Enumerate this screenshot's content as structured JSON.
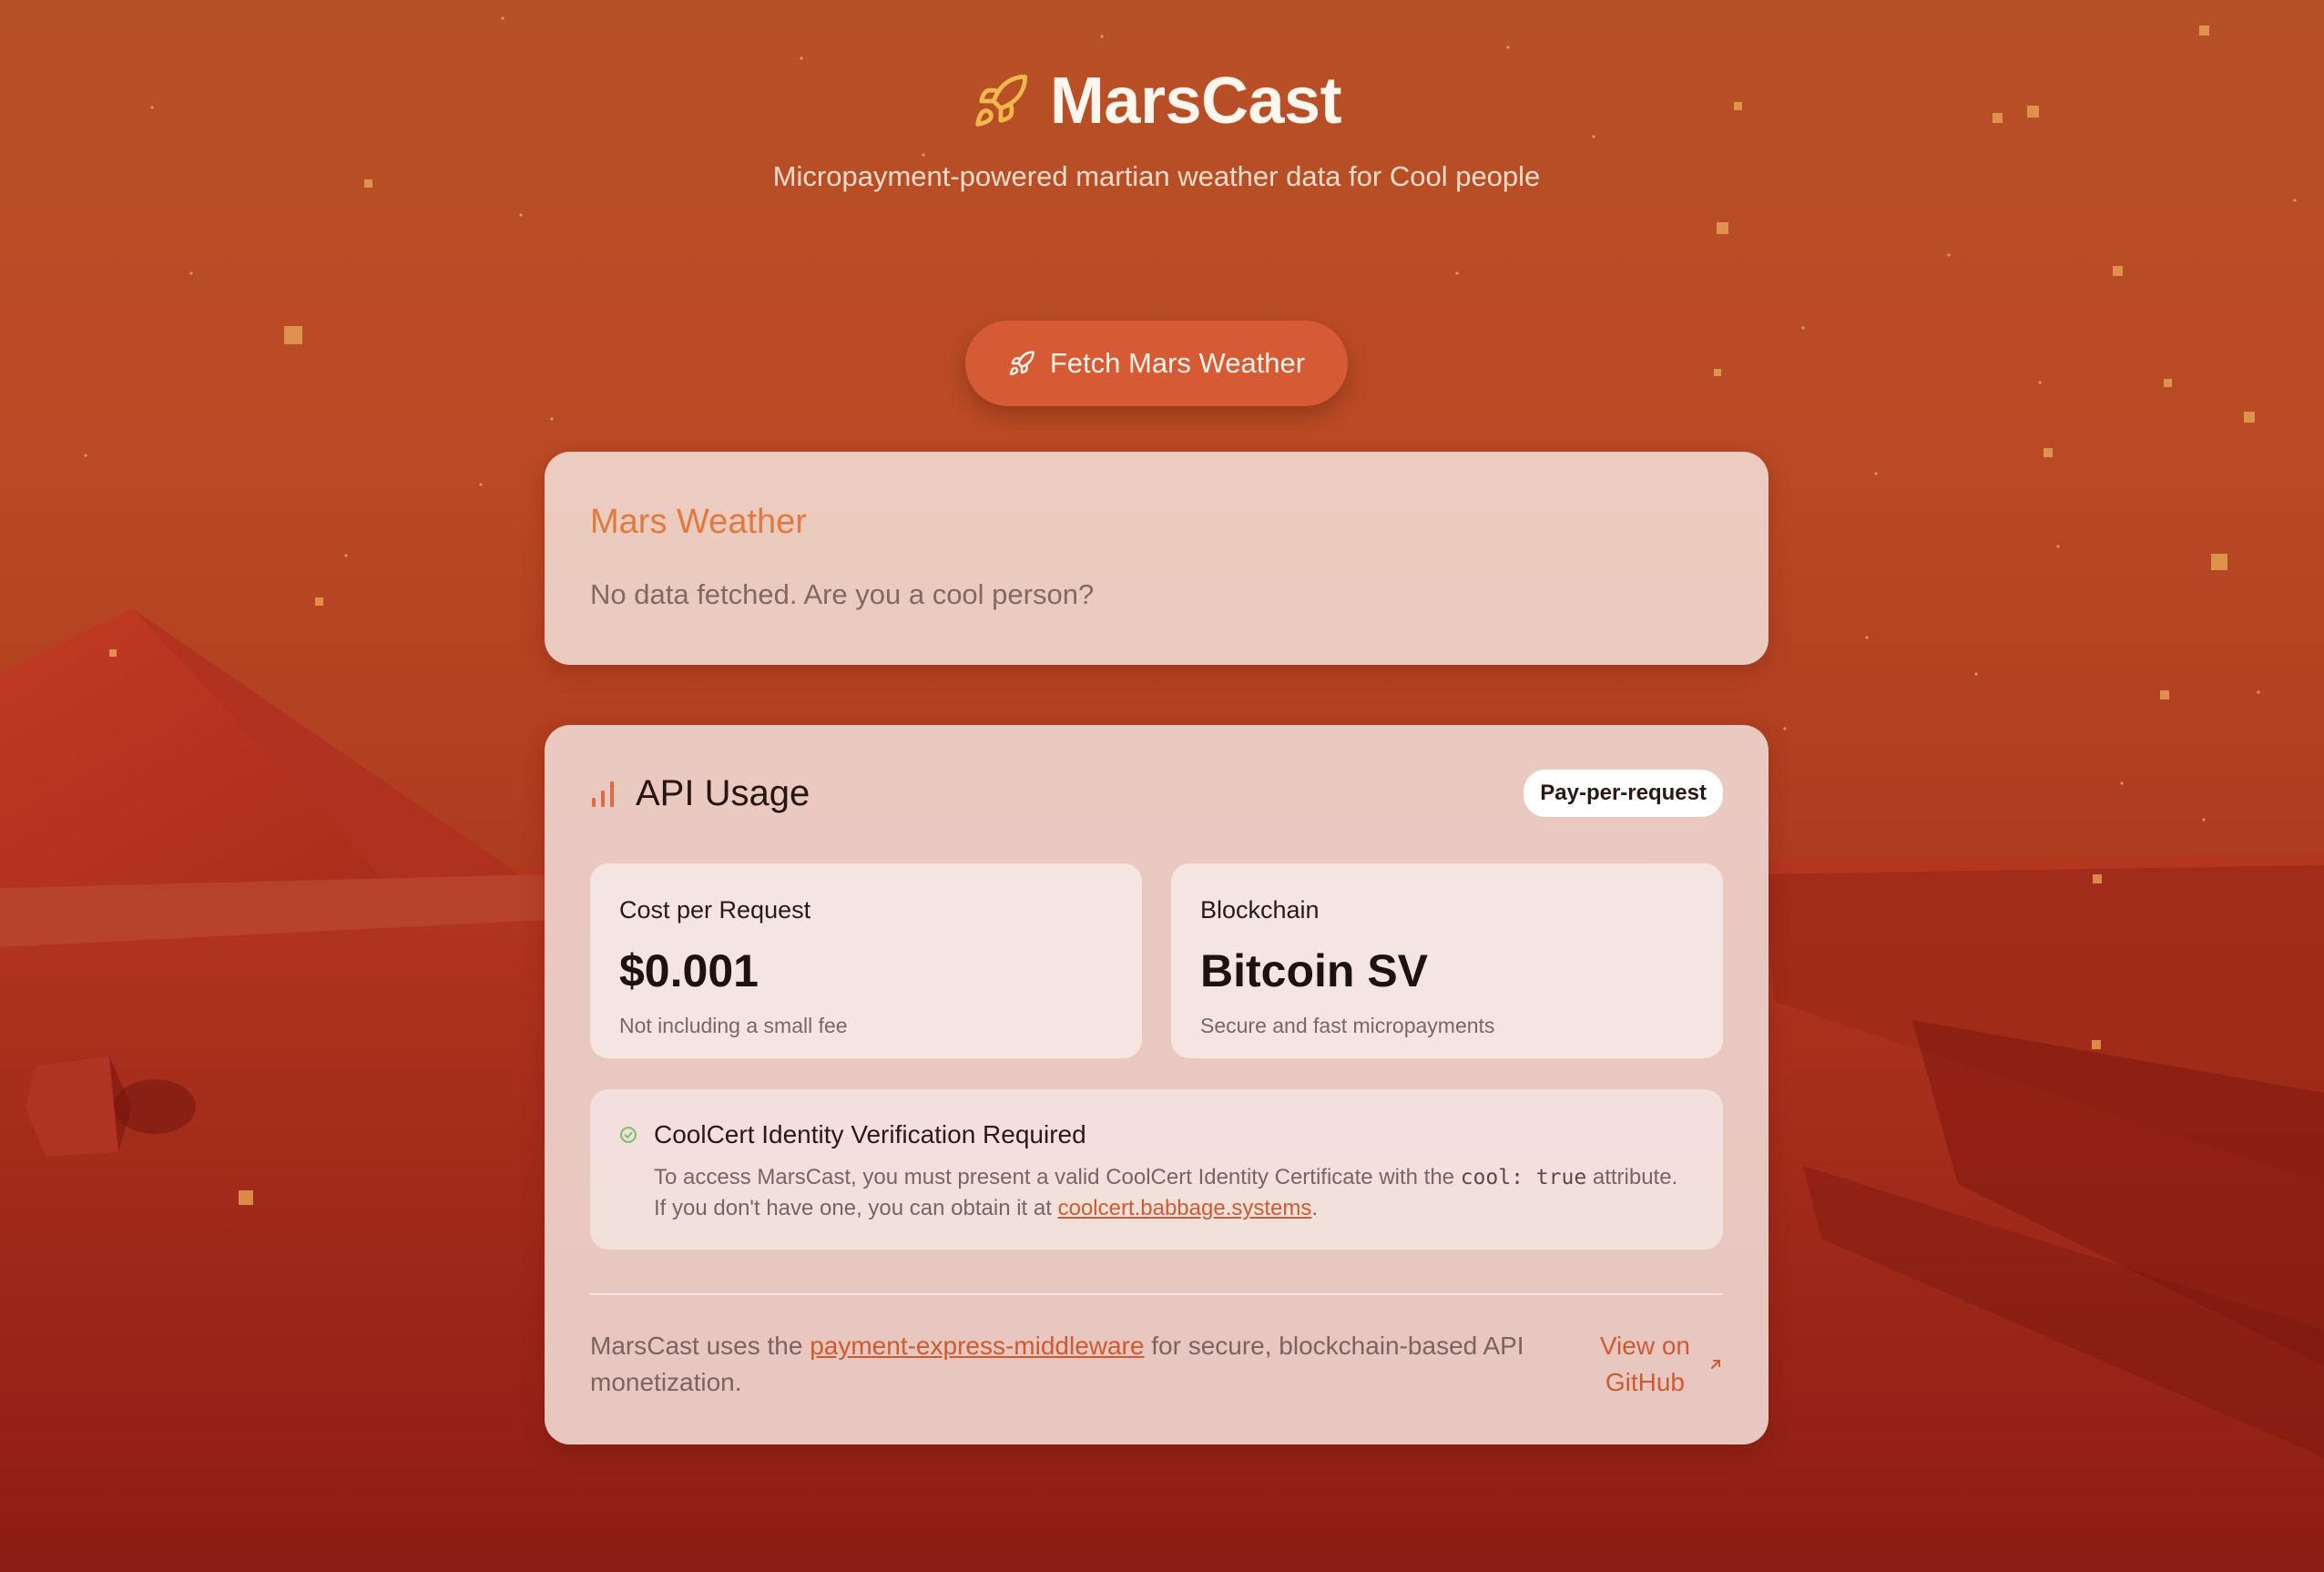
{
  "app": {
    "title": "MarsCast",
    "tagline": "Micropayment-powered martian weather data for Cool people"
  },
  "fetch_button": {
    "label": "Fetch Mars Weather",
    "icon": "rocket-icon"
  },
  "weather": {
    "title": "Mars Weather",
    "empty_message": "No data fetched. Are you a cool person?"
  },
  "usage": {
    "title": "API Usage",
    "icon": "bar-chart-icon",
    "badge": "Pay-per-request",
    "cost": {
      "label": "Cost per Request",
      "value": "$0.001",
      "sub": "Not including a small fee"
    },
    "chain": {
      "label": "Blockchain",
      "value": "Bitcoin SV",
      "sub": "Secure and fast micropayments"
    },
    "cert": {
      "title": "CoolCert Identity Verification Required",
      "text_before": "To access MarsCast, you must present a valid CoolCert Identity Certificate with the ",
      "code": "cool: true",
      "text_middle": " attribute. If you don't have one, you can obtain it at ",
      "link": "coolcert.babbage.systems",
      "text_after": "."
    },
    "footer": {
      "text_before": "MarsCast uses the ",
      "link": "payment-express-middleware",
      "text_after": " for secure, blockchain-based API monetization.",
      "github_line1": "View on",
      "github_line2": "GitHub"
    }
  },
  "colors": {
    "accent": "#d65a33",
    "weather_title": "#e07a3f",
    "link": "#d05a30",
    "success": "#7bbf6a"
  }
}
